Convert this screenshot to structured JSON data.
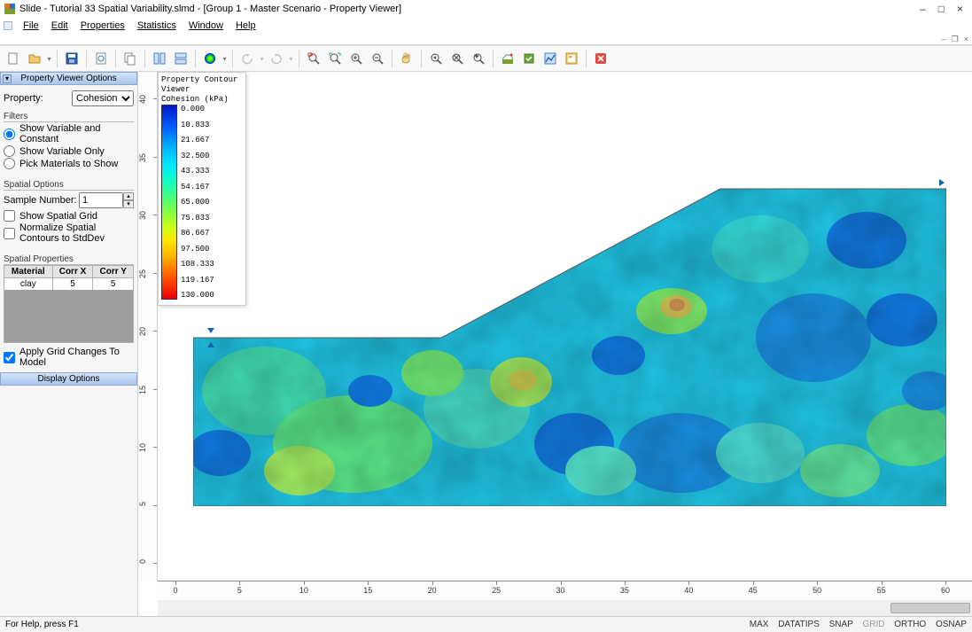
{
  "window": {
    "title": "Slide - Tutorial 33 Spatial Variability.slmd - [Group 1 - Master Scenario - Property Viewer]",
    "controls": {
      "min": "–",
      "max": "□",
      "close": "×"
    },
    "mdi": {
      "min": "–",
      "max": "❐",
      "close": "×"
    }
  },
  "menu": [
    "File",
    "Edit",
    "Properties",
    "Statistics",
    "Window",
    "Help"
  ],
  "sidebar": {
    "panel_options_title": "Property Viewer Options",
    "property_label": "Property:",
    "property_value": "Cohesion",
    "filters_label": "Filters",
    "filter_radios": [
      {
        "label": "Show Variable and Constant",
        "checked": true
      },
      {
        "label": "Show Variable Only",
        "checked": false
      },
      {
        "label": "Pick Materials to Show",
        "checked": false
      }
    ],
    "spatial_options_label": "Spatial Options",
    "sample_number_label": "Sample Number:",
    "sample_number_value": "1",
    "show_spatial_grid": {
      "label": "Show Spatial Grid",
      "checked": false
    },
    "normalize_contours": {
      "label": "Normalize Spatial Contours to StdDev",
      "checked": false
    },
    "spatial_props_label": "Spatial Properties",
    "prop_table": {
      "headers": [
        "Material",
        "Corr X",
        "Corr Y"
      ],
      "rows": [
        [
          "clay",
          "5",
          "5"
        ]
      ]
    },
    "apply_grid": {
      "label": "Apply Grid Changes To Model",
      "checked": true
    },
    "display_options_title": "Display Options"
  },
  "legend": {
    "title1": "Property Contour Viewer",
    "title2": "Cohesion (kPa)",
    "values": [
      "0.000",
      "10.833",
      "21.667",
      "32.500",
      "43.333",
      "54.167",
      "65.000",
      "75.833",
      "86.667",
      "97.500",
      "108.333",
      "119.167",
      "130.000"
    ]
  },
  "ruler": {
    "x_ticks": [
      "0",
      "5",
      "10",
      "15",
      "20",
      "25",
      "30",
      "35",
      "40",
      "45",
      "50",
      "55",
      "60"
    ],
    "y_ticks": [
      "0",
      "5",
      "10",
      "15",
      "20",
      "25",
      "30",
      "35",
      "40"
    ]
  },
  "statusbar": {
    "left": "For Help, press F1",
    "right": [
      "MAX",
      "DATATIPS",
      "SNAP",
      "GRID",
      "ORTHO",
      "OSNAP"
    ]
  },
  "chart_data": {
    "type": "heatmap",
    "title": "Property Contour Viewer — Cohesion (kPa)",
    "xlabel": "",
    "ylabel": "",
    "xlim": [
      0,
      60
    ],
    "ylim": [
      0,
      40
    ],
    "colorbar_range": [
      0,
      130
    ],
    "colorbar_label": "Cohesion (kPa)",
    "colorbar_ticks": [
      0.0,
      10.833,
      21.667,
      32.5,
      43.333,
      54.167,
      65.0,
      75.833,
      86.667,
      97.5,
      108.333,
      119.167,
      130.0
    ],
    "note": "Spatially varying random field of cohesion over slope geometry; values visually range roughly 0–100 kPa (blue–green–yellow–orange). Individual cell values not legible from image."
  }
}
